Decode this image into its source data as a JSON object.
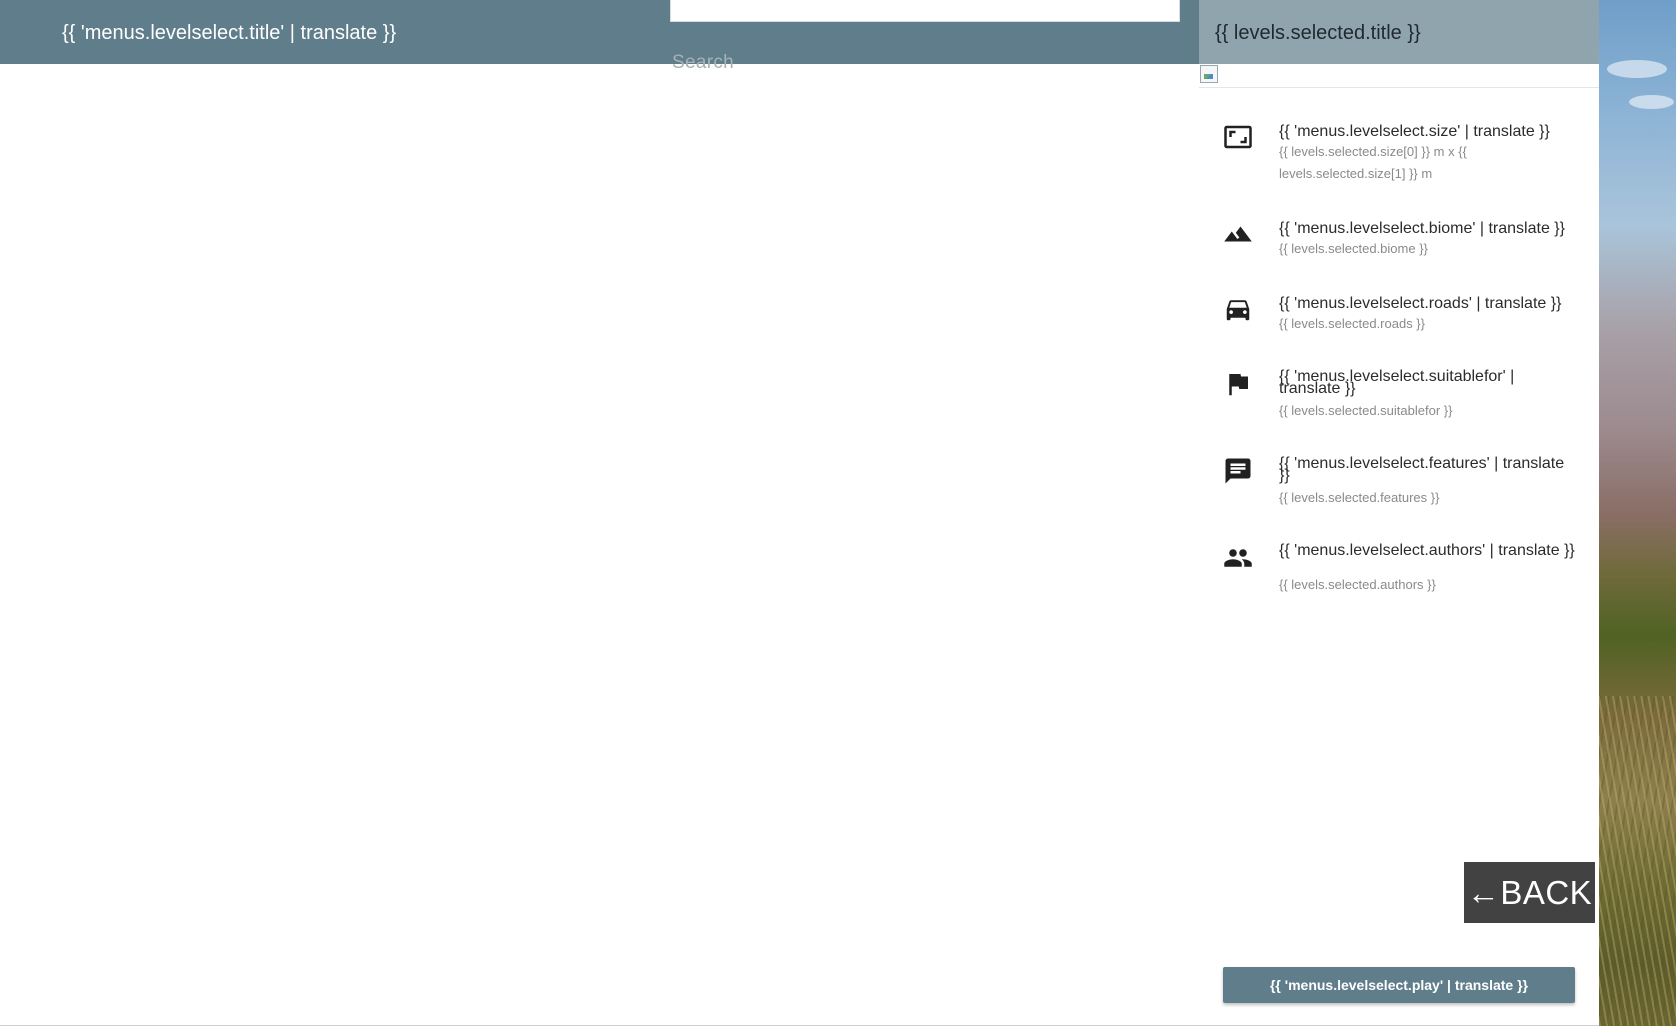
{
  "header": {
    "title": "{{ 'menus.levelselect.title' | translate }}",
    "search_label": "Search"
  },
  "details": {
    "title": "{{ levels.selected.title }}",
    "items": [
      {
        "icon": "size-icon",
        "label": "{{ 'menus.levelselect.size' | translate }}",
        "value": "{{ levels.selected.size[0] }} m x {{ levels.selected.size[1] }} m"
      },
      {
        "icon": "terrain-icon",
        "label": "{{ 'menus.levelselect.biome' | translate }}",
        "value": "{{ levels.selected.biome }}"
      },
      {
        "icon": "car-icon",
        "label": "{{ 'menus.levelselect.roads' | translate }}",
        "value": "{{ levels.selected.roads }}"
      },
      {
        "icon": "flag-icon",
        "label": "{{ 'menus.levelselect.suitablefor' | translate }}",
        "value": "{{ levels.selected.suitablefor }}"
      },
      {
        "icon": "chat-icon",
        "label": "{{ 'menus.levelselect.features' | translate }}",
        "value": "{{ levels.selected.features }}"
      },
      {
        "icon": "people-icon",
        "label": "{{ 'menus.levelselect.authors' | translate }}",
        "value": "{{ levels.selected.authors }}"
      }
    ]
  },
  "buttons": {
    "back_label": "←BACK",
    "play_label": "{{ 'menus.levelselect.play' | translate }}"
  },
  "colors": {
    "header_bg": "#607d8b",
    "details_header_bg": "#90a4ae",
    "back_button_bg": "#424242",
    "play_button_bg": "#607d8b"
  }
}
